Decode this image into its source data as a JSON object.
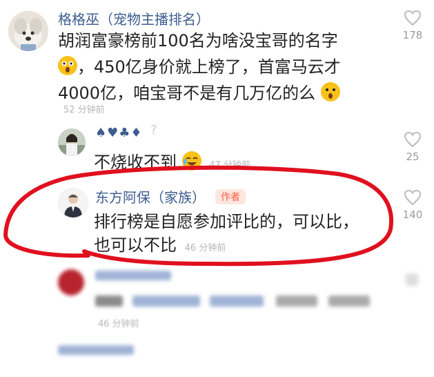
{
  "comments": [
    {
      "username": "格格巫（宠物主播排名）",
      "line1": "胡润富豪榜前100名为啥没宝哥的名字",
      "line2_post": "，450亿身价就上榜了，首富马云才",
      "line3": "4000亿，咱宝哥不是有几万亿的么",
      "time": "52 分钟前",
      "likes": "178"
    },
    {
      "username": "♠♥♣♦",
      "text": "不烧收不到",
      "time": "47 分钟前",
      "likes": "25"
    },
    {
      "username": "东方阿保（家族）",
      "author_tag": "作者",
      "line1": "排行榜是自愿参加评比的，可以比，",
      "line2": "也可以不比",
      "time": "46 分钟前",
      "likes": "140"
    },
    {
      "time": "46 分钟前"
    }
  ],
  "colors": {
    "username": "#3d5d8f",
    "highlight": "#e0101f",
    "author_tag": "#ff5a3c"
  },
  "icons": [
    "heart-outline-icon"
  ]
}
